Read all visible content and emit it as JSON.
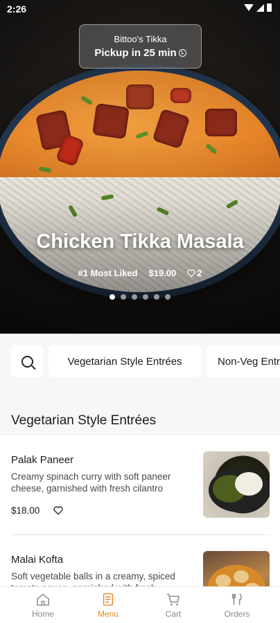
{
  "status_bar": {
    "time": "2:26"
  },
  "hero": {
    "store_name": "Bittoo's Tikka",
    "pickup_text": "Pickup in 25 min",
    "dish_title": "Chicken Tikka Masala",
    "badge": "#1 Most Liked",
    "price": "$19.00",
    "likes": "2",
    "carousel": {
      "total": 6,
      "active_index": 0
    }
  },
  "categories": {
    "search_icon": "search-icon",
    "items": [
      "Vegetarian Style Entrées",
      "Non-Veg Entrées"
    ]
  },
  "section": {
    "title": "Vegetarian Style Entrées",
    "items": [
      {
        "name": "Palak Paneer",
        "description": "Creamy spinach curry with soft paneer cheese, garnished with fresh cilantro",
        "price": "$18.00"
      },
      {
        "name": "Malai Kofta",
        "description": "Soft vegetable balls in a creamy, spiced tomato sauce, garnished with fresh cilantro",
        "price": ""
      }
    ]
  },
  "bottom_nav": {
    "active": "Menu",
    "accent_color": "#e8862a",
    "items": [
      {
        "label": "Home",
        "icon": "home-icon"
      },
      {
        "label": "Menu",
        "icon": "menu-icon"
      },
      {
        "label": "Cart",
        "icon": "cart-icon"
      },
      {
        "label": "Orders",
        "icon": "orders-icon"
      }
    ]
  }
}
